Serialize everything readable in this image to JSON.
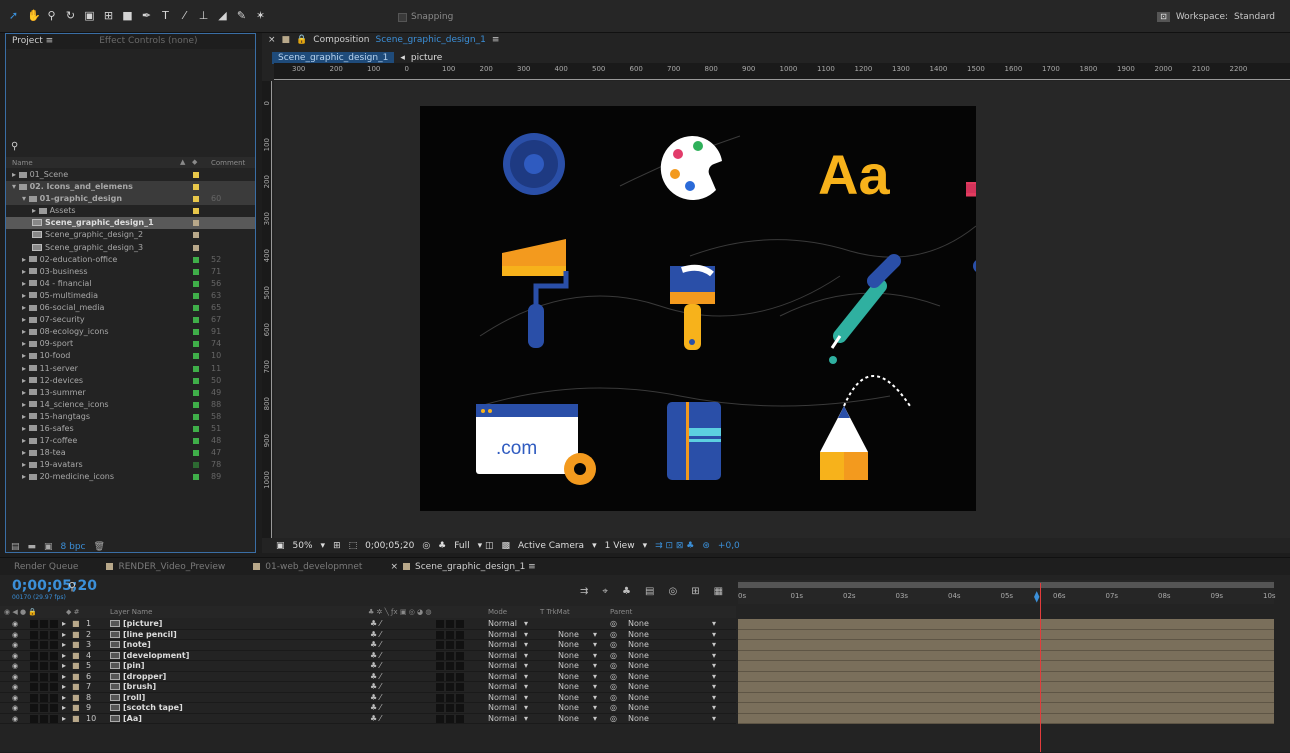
{
  "toolbar": {
    "snapping_label": "Snapping",
    "workspace_prefix": "Workspace:",
    "workspace_value": "Standard"
  },
  "project_panel": {
    "tab_project": "Project ≡",
    "tab_effects": "Effect Controls (none)",
    "search_placeholder": "",
    "col_name": "Name",
    "col_comment": "Comment",
    "bpc_label": "8 bpc",
    "items": [
      {
        "name": "01_Scene",
        "indent": 0,
        "type": "folder",
        "label": "#e8c74a",
        "comment": "",
        "state": ""
      },
      {
        "name": "02. Icons_and_elemens",
        "indent": 0,
        "type": "folder",
        "label": "#e8c74a",
        "comment": "",
        "state": "hl",
        "bold": true
      },
      {
        "name": "01-graphic_design",
        "indent": 1,
        "type": "folder",
        "label": "#e8c74a",
        "comment": "60",
        "state": "hl",
        "bold": true
      },
      {
        "name": "Assets",
        "indent": 2,
        "type": "folder",
        "label": "#e8c74a",
        "comment": "",
        "state": ""
      },
      {
        "name": "Scene_graphic_design_1",
        "indent": 2,
        "type": "comp",
        "label": "#b8a88a",
        "comment": "",
        "state": "sel",
        "bold": true
      },
      {
        "name": "Scene_graphic_design_2",
        "indent": 2,
        "type": "comp",
        "label": "#b8a88a",
        "comment": "",
        "state": ""
      },
      {
        "name": "Scene_graphic_design_3",
        "indent": 2,
        "type": "comp",
        "label": "#b8a88a",
        "comment": "",
        "state": ""
      },
      {
        "name": "02-education-office",
        "indent": 1,
        "type": "folder",
        "label": "#3fae49",
        "comment": "52",
        "state": ""
      },
      {
        "name": "03-business",
        "indent": 1,
        "type": "folder",
        "label": "#3fae49",
        "comment": "71",
        "state": ""
      },
      {
        "name": "04 - financial",
        "indent": 1,
        "type": "folder",
        "label": "#3fae49",
        "comment": "56",
        "state": ""
      },
      {
        "name": "05-multimedia",
        "indent": 1,
        "type": "folder",
        "label": "#3fae49",
        "comment": "63",
        "state": ""
      },
      {
        "name": "06-social_media",
        "indent": 1,
        "type": "folder",
        "label": "#3fae49",
        "comment": "65",
        "state": ""
      },
      {
        "name": "07-security",
        "indent": 1,
        "type": "folder",
        "label": "#3fae49",
        "comment": "67",
        "state": ""
      },
      {
        "name": "08-ecology_icons",
        "indent": 1,
        "type": "folder",
        "label": "#3fae49",
        "comment": "91",
        "state": ""
      },
      {
        "name": "09-sport",
        "indent": 1,
        "type": "folder",
        "label": "#3fae49",
        "comment": "74",
        "state": ""
      },
      {
        "name": "10-food",
        "indent": 1,
        "type": "folder",
        "label": "#3fae49",
        "comment": "10",
        "state": ""
      },
      {
        "name": "11-server",
        "indent": 1,
        "type": "folder",
        "label": "#3fae49",
        "comment": "11",
        "state": ""
      },
      {
        "name": "12-devices",
        "indent": 1,
        "type": "folder",
        "label": "#3fae49",
        "comment": "50",
        "state": ""
      },
      {
        "name": "13-summer",
        "indent": 1,
        "type": "folder",
        "label": "#3fae49",
        "comment": "49",
        "state": ""
      },
      {
        "name": "14_science_icons",
        "indent": 1,
        "type": "folder",
        "label": "#3fae49",
        "comment": "88",
        "state": ""
      },
      {
        "name": "15-hangtags",
        "indent": 1,
        "type": "folder",
        "label": "#3fae49",
        "comment": "58",
        "state": ""
      },
      {
        "name": "16-safes",
        "indent": 1,
        "type": "folder",
        "label": "#3fae49",
        "comment": "51",
        "state": ""
      },
      {
        "name": "17-coffee",
        "indent": 1,
        "type": "folder",
        "label": "#3fae49",
        "comment": "48",
        "state": ""
      },
      {
        "name": "18-tea",
        "indent": 1,
        "type": "folder",
        "label": "#3fae49",
        "comment": "47",
        "state": ""
      },
      {
        "name": "19-avatars",
        "indent": 1,
        "type": "folder",
        "label": "#2d6a32",
        "comment": "78",
        "state": ""
      },
      {
        "name": "20-medicine_icons",
        "indent": 1,
        "type": "folder",
        "label": "#3fae49",
        "comment": "89",
        "state": ""
      }
    ]
  },
  "composition": {
    "tab_prefix": "Composition",
    "tab_name": "Scene_graphic_design_1",
    "crumb_active": "Scene_graphic_design_1",
    "crumb_next": "picture",
    "ruler_h": [
      "300",
      "200",
      "100",
      "0",
      "100",
      "200",
      "300",
      "400",
      "500",
      "600",
      "700",
      "800",
      "900",
      "1000",
      "1100",
      "1200",
      "1300",
      "1400",
      "1500",
      "1600",
      "1700",
      "1800",
      "1900",
      "2000",
      "2100",
      "2200"
    ],
    "ruler_v": [
      "0",
      "100",
      "200",
      "300",
      "400",
      "500",
      "600",
      "700",
      "800",
      "900",
      "1000"
    ],
    "viewer": {
      "zoom": "50%",
      "timecode": "0;00;05;20",
      "resolution": "Full",
      "camera": "Active Camera",
      "views": "1 View",
      "exposure": "+0,0"
    },
    "canvas_text": {
      "aa": "Aa",
      "com": ".com"
    }
  },
  "timeline": {
    "tabs": [
      {
        "label": "Render Queue",
        "color": ""
      },
      {
        "label": "RENDER_Video_Preview",
        "color": "#b8a88a"
      },
      {
        "label": "01-web_developmnet",
        "color": "#b8a88a"
      },
      {
        "label": "Scene_graphic_design_1 ≡",
        "color": "#b8a88a",
        "active": true
      }
    ],
    "timecode": "0;00;05;20",
    "timecode_sub": "00170 (29.97 fps)",
    "headers": {
      "layer_name": "Layer Name",
      "mode": "Mode",
      "trkmat": "T  TrkMat",
      "parent": "Parent"
    },
    "ruler_labels": [
      "0s",
      "01s",
      "02s",
      "03s",
      "04s",
      "05s",
      "06s",
      "07s",
      "08s",
      "09s",
      "10s"
    ],
    "layers": [
      {
        "num": "1",
        "name": "[picture]",
        "mode": "Normal",
        "trkmat": "",
        "parent": "None"
      },
      {
        "num": "2",
        "name": "[line pencil]",
        "mode": "Normal",
        "trkmat": "None",
        "parent": "None"
      },
      {
        "num": "3",
        "name": "[note]",
        "mode": "Normal",
        "trkmat": "None",
        "parent": "None"
      },
      {
        "num": "4",
        "name": "[development]",
        "mode": "Normal",
        "trkmat": "None",
        "parent": "None"
      },
      {
        "num": "5",
        "name": "[pin]",
        "mode": "Normal",
        "trkmat": "None",
        "parent": "None"
      },
      {
        "num": "6",
        "name": "[dropper]",
        "mode": "Normal",
        "trkmat": "None",
        "parent": "None"
      },
      {
        "num": "7",
        "name": "[brush]",
        "mode": "Normal",
        "trkmat": "None",
        "parent": "None"
      },
      {
        "num": "8",
        "name": "[roll]",
        "mode": "Normal",
        "trkmat": "None",
        "parent": "None"
      },
      {
        "num": "9",
        "name": "[scotch tape]",
        "mode": "Normal",
        "trkmat": "None",
        "parent": "None"
      },
      {
        "num": "10",
        "name": "[Aa]",
        "mode": "Normal",
        "trkmat": "None",
        "parent": "None"
      }
    ]
  }
}
